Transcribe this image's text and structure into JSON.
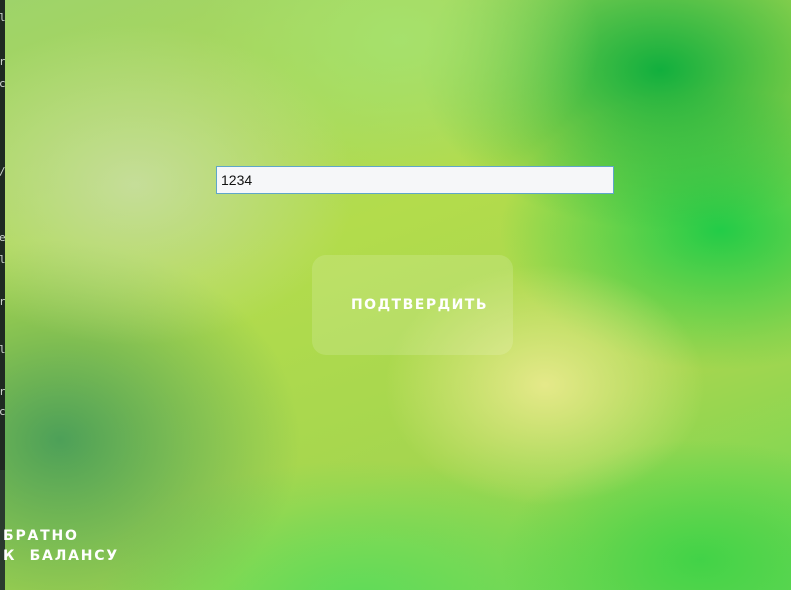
{
  "code_input": {
    "value": "1234"
  },
  "confirm_button": {
    "label": "ПОДТВЕРДИТЬ"
  },
  "back_link": {
    "line1": "БРАТНО",
    "line2": "К  БАЛАНСУ"
  },
  "left_strip": {
    "glyphs": [
      "l",
      "r",
      "c",
      "/",
      "e",
      "l",
      "r",
      "l",
      "r",
      "c"
    ]
  }
}
